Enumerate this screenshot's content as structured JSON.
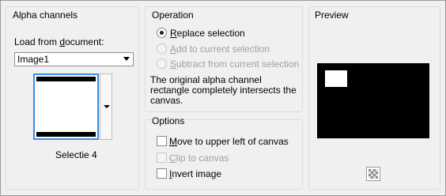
{
  "alpha_channels": {
    "title": "Alpha channels",
    "load_label_pre": "Load from ",
    "load_label_accel": "d",
    "load_label_post": "ocument:",
    "document_value": "Image1",
    "channel_name": "Selectie 4"
  },
  "operation": {
    "title": "Operation",
    "options": [
      {
        "accel": "R",
        "rest": "eplace selection",
        "checked": true,
        "enabled": true
      },
      {
        "accel": "A",
        "rest": "dd to current selection",
        "checked": false,
        "enabled": false
      },
      {
        "accel": "S",
        "rest": "ubtract from current selection",
        "checked": false,
        "enabled": false
      }
    ],
    "message_line1": "The original alpha channel",
    "message_line2": "rectangle completely intersects the",
    "message_line3": "canvas."
  },
  "options": {
    "title": "Options",
    "items": [
      {
        "accel": "M",
        "rest": "ove to upper left of canvas",
        "checked": false,
        "enabled": true
      },
      {
        "accel": "C",
        "rest": "lip to canvas",
        "checked": false,
        "enabled": false
      },
      {
        "accel": "I",
        "rest": "nvert image",
        "checked": false,
        "enabled": true
      }
    ]
  },
  "preview": {
    "title": "Preview"
  },
  "icons": {
    "dropdown": "chevron-down-icon",
    "transparency": "checkerboard-icon"
  },
  "colors": {
    "selection_border": "#3a8ee6",
    "canvas": "#000000",
    "selection_fill": "#ffffff"
  }
}
